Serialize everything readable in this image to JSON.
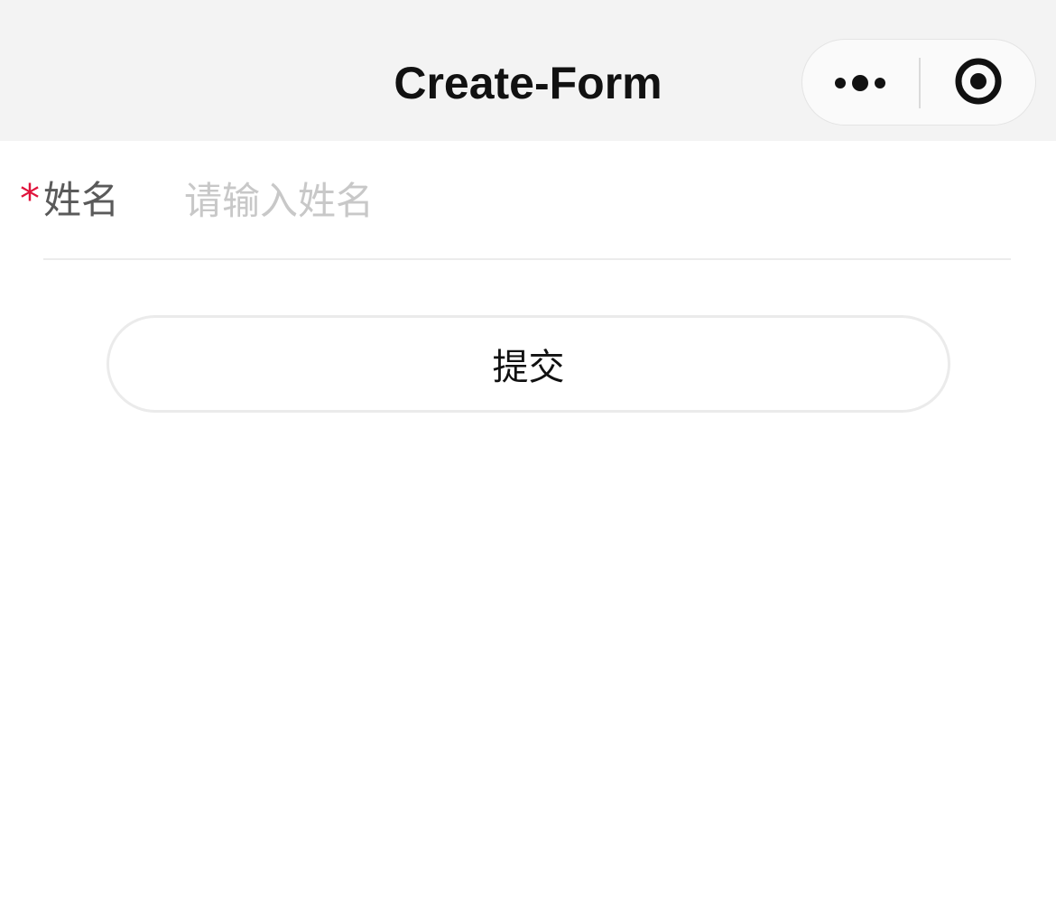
{
  "nav": {
    "title": "Create-Form",
    "background": "#f3f3f3",
    "capsule": {
      "more_icon": "more-dots-icon",
      "close_icon": "target-close-icon"
    }
  },
  "form": {
    "fields": [
      {
        "required_mark": "*",
        "required_color": "#e0143c",
        "label": "姓名",
        "value": "",
        "placeholder": "请输入姓名"
      }
    ],
    "submit_label": "提交"
  }
}
